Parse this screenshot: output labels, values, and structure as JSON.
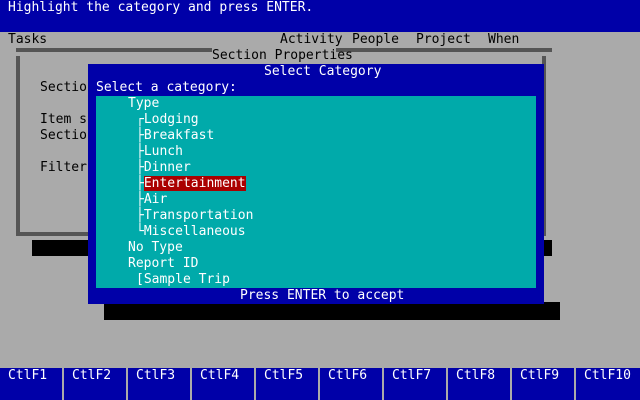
{
  "instruction": "Highlight the category and press ENTER.",
  "menu": {
    "tasks": "Tasks",
    "activity": "Activity",
    "people": "People",
    "project": "Project",
    "when": "When"
  },
  "section_properties": {
    "title": "Section Properties",
    "labels": [
      "Sectio",
      "Item s",
      "Sectio",
      "Filter"
    ]
  },
  "select_category": {
    "title": "Select Category",
    "prompt": "Select a category:",
    "tree": [
      {
        "text": "Type"
      },
      {
        "text": "┌Lodging"
      },
      {
        "text": "├Breakfast"
      },
      {
        "text": "├Lunch"
      },
      {
        "text": "├Dinner"
      },
      {
        "text": "├",
        "selected_text": "Entertainment"
      },
      {
        "text": "├Air"
      },
      {
        "text": "├Transportation"
      },
      {
        "text": "└Miscellaneous"
      },
      {
        "text": "No Type"
      },
      {
        "text": "Report ID"
      },
      {
        "text": "[Sample Trip"
      }
    ],
    "footer": "Press ENTER to accept"
  },
  "function_keys": [
    "CtlF1",
    "CtlF2",
    "CtlF3",
    "CtlF4",
    "CtlF5",
    "CtlF6",
    "CtlF7",
    "CtlF8",
    "CtlF9",
    "CtlF10"
  ],
  "colors": {
    "dos_blue": "#0000a8",
    "cyan": "#00aaaa",
    "gray": "#aaaaaa",
    "dark_gray": "#555555",
    "selection_red": "#aa0000"
  }
}
